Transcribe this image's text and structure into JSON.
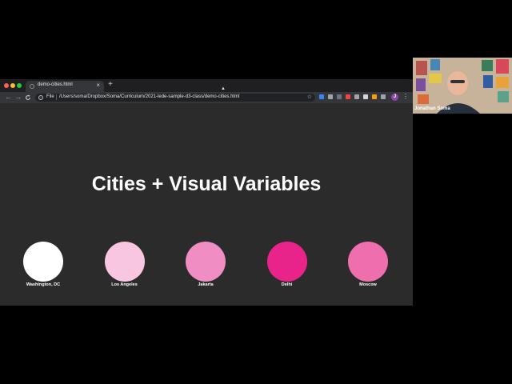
{
  "browser": {
    "tab": {
      "title": "demo-cities.html",
      "close": "×"
    },
    "new_tab": "+",
    "scheme_label": "File",
    "url": "/Users/soma/Dropbox/Soma/Curriculum/2021-lede-sample-d3-class/demo-cities.html",
    "nav": {
      "back": "←",
      "forward": "→",
      "reload": "C"
    },
    "star": "☆",
    "profile_initial": "J",
    "menu": "⋮",
    "extension_colors": [
      "#3b82f6",
      "#9ca3af",
      "#6b7280",
      "#ef4444",
      "#a3a3a3",
      "#d1d5db",
      "#f59e0b",
      "#9ca3af"
    ]
  },
  "page": {
    "title": "Cities + Visual Variables",
    "cities": [
      {
        "name": "Washington, DC",
        "color": "#ffffff"
      },
      {
        "name": "Los Angeles",
        "color": "#f8c6e0"
      },
      {
        "name": "Jakarta",
        "color": "#f08ec4"
      },
      {
        "name": "Delhi",
        "color": "#e8238a"
      },
      {
        "name": "Moscow",
        "color": "#ef6fae"
      }
    ]
  },
  "video": {
    "participant_name": "Jonathan Soma"
  }
}
